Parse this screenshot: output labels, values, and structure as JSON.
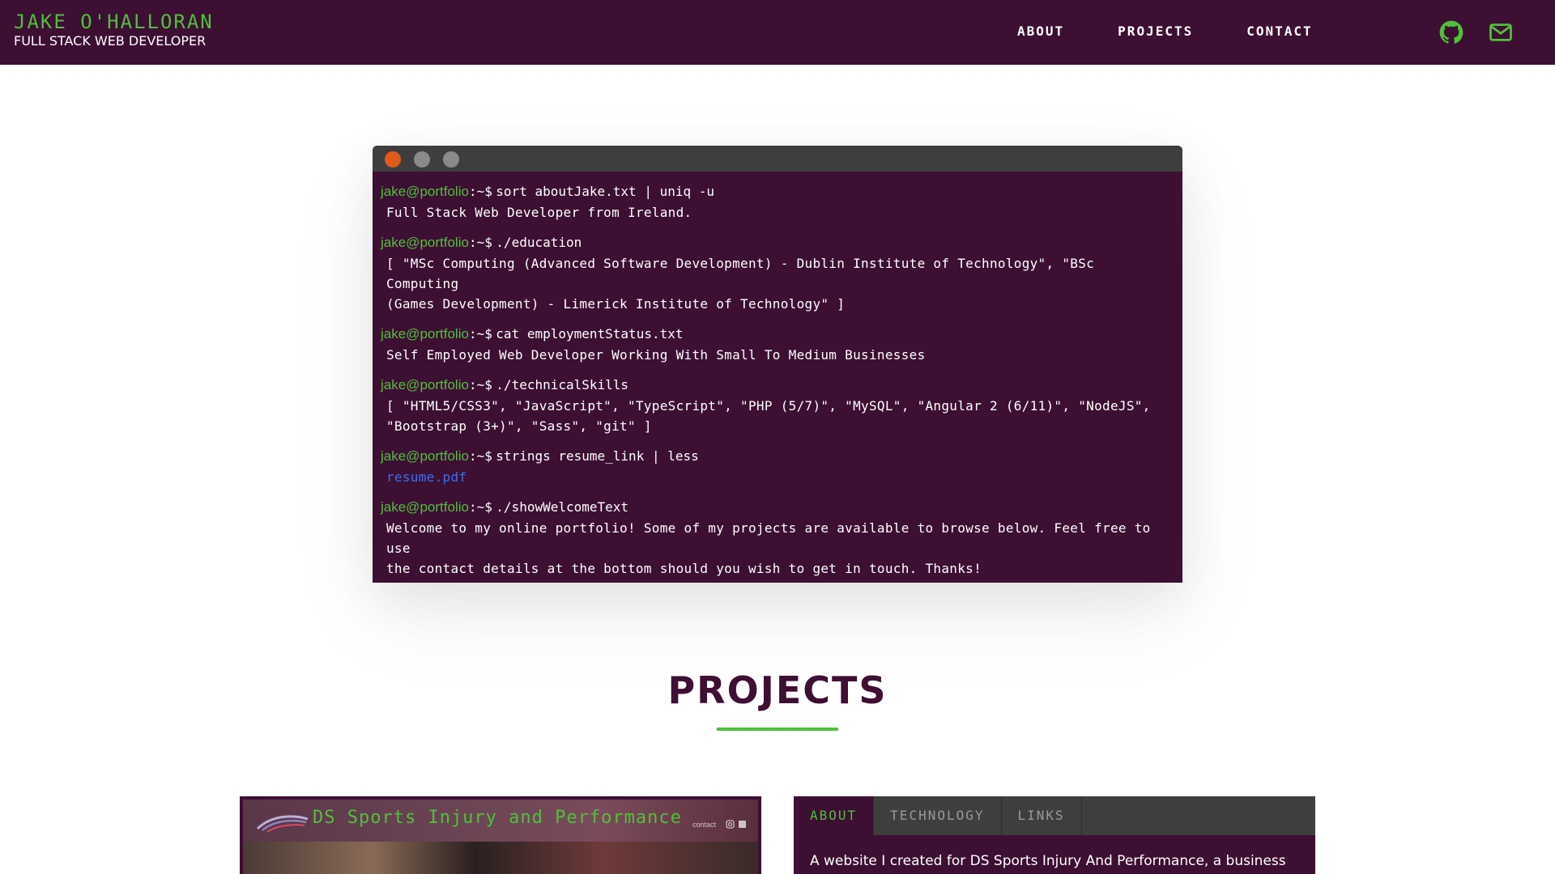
{
  "header": {
    "name": "JAKE O'HALLORAN",
    "role": "FULL STACK WEB DEVELOPER",
    "nav": [
      {
        "label": "ABOUT"
      },
      {
        "label": "PROJECTS"
      },
      {
        "label": "CONTACT"
      }
    ],
    "social": [
      {
        "icon": "github-icon"
      },
      {
        "icon": "mail-icon"
      }
    ]
  },
  "terminal": {
    "prompt_user": "jake@portfolio",
    "prompt_symbol": ":~$",
    "commands": [
      {
        "command": "sort aboutJake.txt | uniq -u",
        "output": [
          "Full Stack Web Developer from Ireland."
        ]
      },
      {
        "command": "./education",
        "output": [
          "[ \"MSc Computing (Advanced Software Development) - Dublin Institute of Technology\", \"BSc Computing",
          "(Games Development) - Limerick Institute of Technology\" ]"
        ]
      },
      {
        "command": "cat employmentStatus.txt",
        "output": [
          "Self Employed Web Developer Working With Small To Medium Businesses"
        ]
      },
      {
        "command": "./technicalSkills",
        "output": [
          "[ \"HTML5/CSS3\", \"JavaScript\", \"TypeScript\", \"PHP (5/7)\", \"MySQL\", \"Angular 2 (6/11)\", \"NodeJS\",",
          "\"Bootstrap (3+)\", \"Sass\", \"git\" ]"
        ]
      },
      {
        "command": "strings resume_link | less",
        "link": "resume.pdf"
      },
      {
        "command": "./showWelcomeText",
        "output": [
          "Welcome to my online portfolio! Some of my projects are available to browse below. Feel free to use",
          "the contact details at the bottom should you wish to get in touch. Thanks!"
        ]
      }
    ]
  },
  "projects": {
    "title": "PROJECTS",
    "card": {
      "screenshot_title": "DS Sports Injury and Performance",
      "screenshot_nav": "contact",
      "tabs": [
        {
          "label": "ABOUT",
          "active": true
        },
        {
          "label": "TECHNOLOGY",
          "active": false
        },
        {
          "label": "LINKS",
          "active": false
        }
      ],
      "description": "A website I created for DS Sports Injury And Performance, a business"
    }
  },
  "colors": {
    "primary": "#3d0f33",
    "accent": "#4fc13a",
    "titlebar": "#3e3e3e",
    "close_dot": "#e05a1b",
    "link": "#3b6ff0"
  }
}
